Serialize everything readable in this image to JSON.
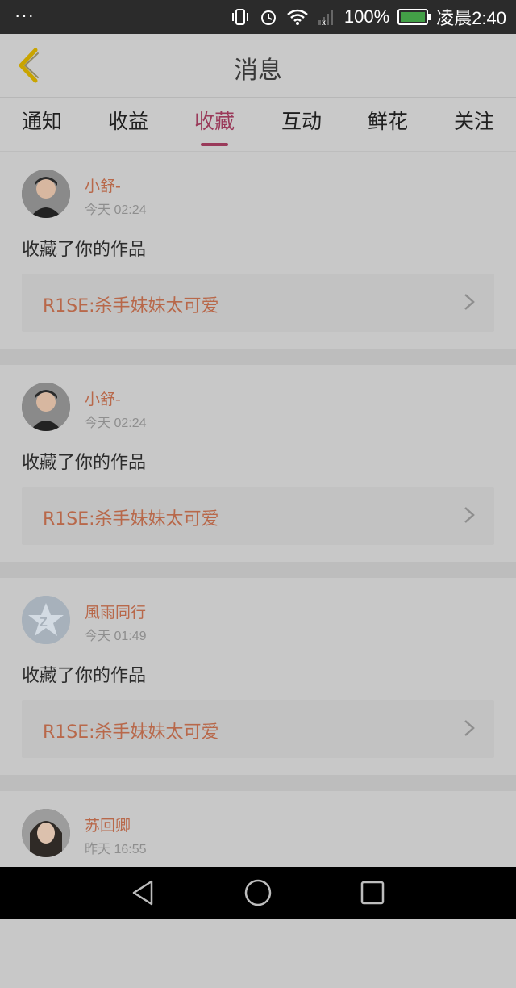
{
  "status_bar": {
    "menu": "···",
    "battery": "100%",
    "time": "凌晨2:40",
    "battery_color": "#43a047",
    "icons": [
      "vibrate-icon",
      "alarm-icon",
      "wifi-icon",
      "signal-icon",
      "battery-icon"
    ]
  },
  "header": {
    "title": "消息",
    "back_icon": "chevron-left-icon",
    "accent": "#c9a400"
  },
  "tabs": [
    {
      "label": "通知",
      "active": false
    },
    {
      "label": "收益",
      "active": false
    },
    {
      "label": "收藏",
      "active": true
    },
    {
      "label": "互动",
      "active": false
    },
    {
      "label": "鲜花",
      "active": false
    },
    {
      "label": "关注",
      "active": false
    }
  ],
  "notifications": [
    {
      "user": "小舒-",
      "time": "今天 02:24",
      "action": "收藏了你的作品",
      "work": "R1SE:杀手妹妹太可爱",
      "avatar": "man-photo"
    },
    {
      "user": "小舒-",
      "time": "今天 02:24",
      "action": "收藏了你的作品",
      "work": "R1SE:杀手妹妹太可爱",
      "avatar": "man-photo"
    },
    {
      "user": "風雨同行",
      "time": "今天 01:49",
      "action": "收藏了你的作品",
      "work": "R1SE:杀手妹妹太可爱",
      "avatar": "default-star"
    },
    {
      "user": "苏回卿",
      "time": "昨天 16:55",
      "action": "",
      "work": "",
      "avatar": "woman-photo"
    }
  ],
  "colors": {
    "tab_active": "#9a3a5a",
    "name_text": "#b8684a"
  },
  "nav_bar": {
    "icons": [
      "back-triangle-icon",
      "home-circle-icon",
      "recents-square-icon"
    ]
  }
}
